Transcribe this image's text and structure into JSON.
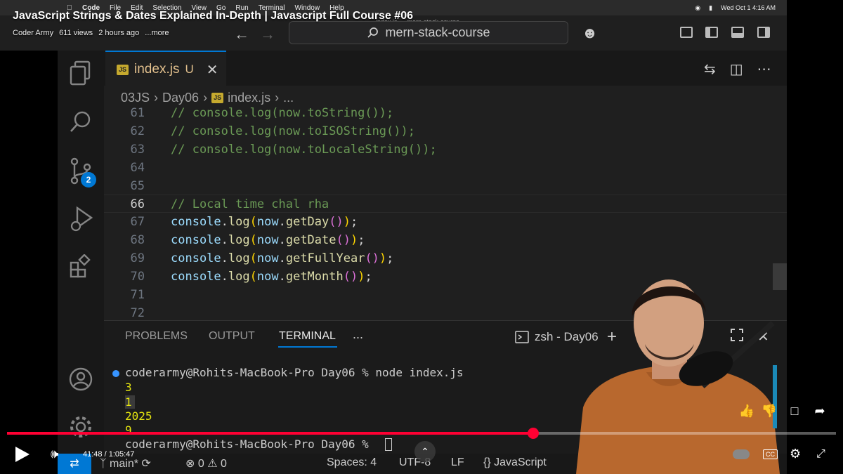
{
  "menubar": {
    "app": "Code",
    "items": [
      "File",
      "Edit",
      "Selection",
      "View",
      "Go",
      "Run",
      "Terminal",
      "Window",
      "Help"
    ],
    "clock": "Wed Oct 1 4:16 AM"
  },
  "youtube": {
    "title": "JavaScript Strings & Dates Explained In-Depth | Javascript Full Course #06",
    "channel": "Coder Army",
    "views": "611 views",
    "age": "2 hours ago",
    "more": "...more",
    "time": "41:48 / 1:05:47",
    "progress_fraction": 0.635
  },
  "window": {
    "title": "index.js — mern-stack-course",
    "command_center": "mern-stack-course"
  },
  "activity": {
    "scm_badge": "2"
  },
  "tab": {
    "icon_label": "JS",
    "name": "index.js",
    "modified": "U"
  },
  "breadcrumb": [
    "03JS",
    "Day06",
    "index.js",
    "..."
  ],
  "editor": {
    "lines": [
      {
        "n": "61",
        "text": "// console.log(now.toString());"
      },
      {
        "n": "62",
        "text": "// console.log(now.toISOString());"
      },
      {
        "n": "63",
        "text": "// console.log(now.toLocaleString());"
      },
      {
        "n": "64",
        "text": ""
      },
      {
        "n": "65",
        "text": ""
      },
      {
        "n": "66",
        "text": "// Local time chal rha"
      },
      {
        "n": "67",
        "obj": "console",
        "method": "log",
        "arg_obj": "now",
        "arg_fn": "getDay"
      },
      {
        "n": "68",
        "obj": "console",
        "method": "log",
        "arg_obj": "now",
        "arg_fn": "getDate"
      },
      {
        "n": "69",
        "obj": "console",
        "method": "log",
        "arg_obj": "now",
        "arg_fn": "getFullYear"
      },
      {
        "n": "70",
        "obj": "console",
        "method": "log",
        "arg_obj": "now",
        "arg_fn": "getMonth"
      },
      {
        "n": "71",
        "text": ""
      },
      {
        "n": "72",
        "text": ""
      }
    ]
  },
  "panel": {
    "tabs": [
      "PROBLEMS",
      "OUTPUT",
      "TERMINAL",
      "..."
    ],
    "terminal_name": "zsh - Day06",
    "command_line": "coderarmy@Rohits-MacBook-Pro Day06 % node index.js",
    "outputs": [
      "3",
      "1",
      "2025",
      "9"
    ],
    "prompt_line": "coderarmy@Rohits-MacBook-Pro Day06 % "
  },
  "statusbar": {
    "branch": "main*",
    "errors": "0",
    "warnings": "0",
    "spaces": "Spaces: 4",
    "encoding": "UTF-8",
    "eol": "LF",
    "language": "JavaScript"
  },
  "colors": {
    "accent": "#0078d4",
    "progress": "#ff0033"
  }
}
